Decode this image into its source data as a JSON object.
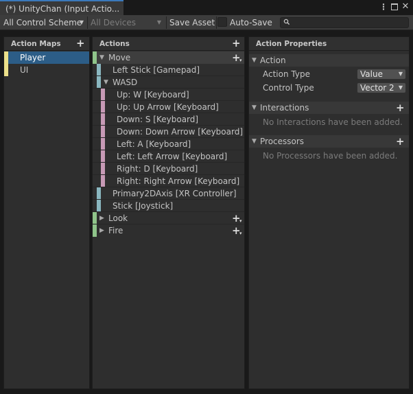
{
  "window": {
    "tab_title": "(*) UnityChan (Input Actio...",
    "menu_icon": "kebab-menu-icon",
    "maximize_icon": "maximize-icon",
    "close_icon": "close-icon"
  },
  "toolbar": {
    "control_scheme": "All Control Scheme",
    "devices": "All Devices",
    "save_asset": "Save Asset",
    "auto_save_label": "Auto-Save",
    "auto_save_checked": false,
    "search_value": "",
    "search_icon": "search-icon"
  },
  "action_maps": {
    "title": "Action Maps",
    "items": [
      {
        "label": "Player",
        "selected": true
      },
      {
        "label": "UI",
        "selected": false
      }
    ]
  },
  "actions": {
    "title": "Actions",
    "items": [
      {
        "label": "Move",
        "kind": "action",
        "expanded": true
      },
      {
        "label": "Left Stick [Gamepad]",
        "kind": "binding"
      },
      {
        "label": "WASD",
        "kind": "composite",
        "expanded": true
      },
      {
        "label": "Up: W [Keyboard]",
        "kind": "part"
      },
      {
        "label": "Up: Up Arrow [Keyboard]",
        "kind": "part"
      },
      {
        "label": "Down: S [Keyboard]",
        "kind": "part"
      },
      {
        "label": "Down: Down Arrow [Keyboard]",
        "kind": "part"
      },
      {
        "label": "Left: A [Keyboard]",
        "kind": "part"
      },
      {
        "label": "Left: Left Arrow [Keyboard]",
        "kind": "part"
      },
      {
        "label": "Right: D [Keyboard]",
        "kind": "part"
      },
      {
        "label": "Right: Right Arrow [Keyboard]",
        "kind": "part"
      },
      {
        "label": "Primary2DAxis [XR Controller]",
        "kind": "binding"
      },
      {
        "label": "Stick [Joystick]",
        "kind": "binding"
      },
      {
        "label": "Look",
        "kind": "action",
        "expanded": false
      },
      {
        "label": "Fire",
        "kind": "action",
        "expanded": false
      }
    ]
  },
  "properties": {
    "title": "Action Properties",
    "action_section": "Action",
    "action_type_label": "Action Type",
    "action_type_value": "Value",
    "control_type_label": "Control Type",
    "control_type_value": "Vector 2",
    "interactions_section": "Interactions",
    "interactions_empty": "No Interactions have been added.",
    "processors_section": "Processors",
    "processors_empty": "No Processors have been added."
  },
  "colors": {
    "selection": "#2c5d87",
    "map_stripe": "#ece08a",
    "action_stripe": "#8fc48a",
    "binding_stripe": "#8ab7c0",
    "part_stripe": "#c79ab6",
    "tab_accent": "#3a79bb"
  }
}
